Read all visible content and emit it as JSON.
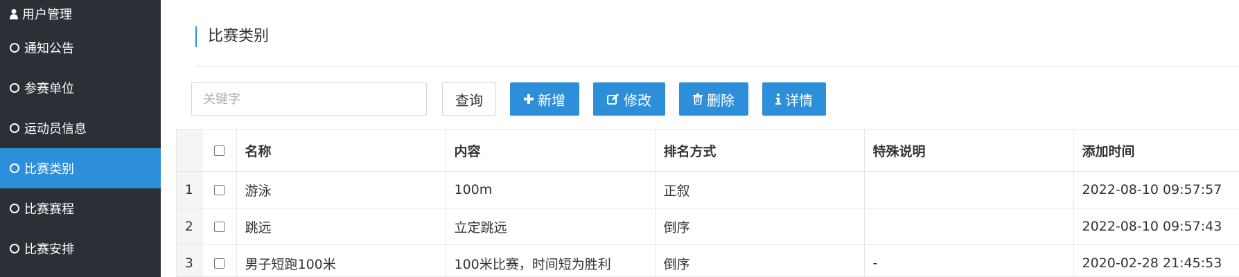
{
  "sidebar": {
    "items": [
      {
        "label": "用户管理",
        "icon": "user-icon"
      },
      {
        "label": "通知公告",
        "icon": "ring-icon"
      },
      {
        "label": "参赛单位",
        "icon": "ring-icon"
      },
      {
        "label": "运动员信息",
        "icon": "ring-icon"
      },
      {
        "label": "比赛类别",
        "icon": "ring-icon",
        "active": true
      },
      {
        "label": "比赛赛程",
        "icon": "ring-icon"
      },
      {
        "label": "比赛安排",
        "icon": "ring-icon"
      }
    ]
  },
  "page": {
    "title": "比赛类别"
  },
  "toolbar": {
    "search_placeholder": "关键字",
    "search_button": "查询",
    "add_button": "新增",
    "edit_button": "修改",
    "delete_button": "删除",
    "detail_button": "详情"
  },
  "table": {
    "headers": [
      "名称",
      "内容",
      "排名方式",
      "特殊说明",
      "添加时间"
    ],
    "rows": [
      {
        "index": "1",
        "name": "游泳",
        "content": "100m",
        "rank": "正叙",
        "note": "",
        "time": "2022-08-10 09:57:57"
      },
      {
        "index": "2",
        "name": "跳远",
        "content": "立定跳远",
        "rank": "倒序",
        "note": "",
        "time": "2022-08-10 09:57:43"
      },
      {
        "index": "3",
        "name": "男子短跑100米",
        "content": "100米比赛，时间短为胜利",
        "rank": "倒序",
        "note": "-",
        "time": "2020-02-28 21:45:53"
      }
    ]
  },
  "colors": {
    "sidebar_bg": "#2b3037",
    "accent": "#2d8fd9"
  }
}
